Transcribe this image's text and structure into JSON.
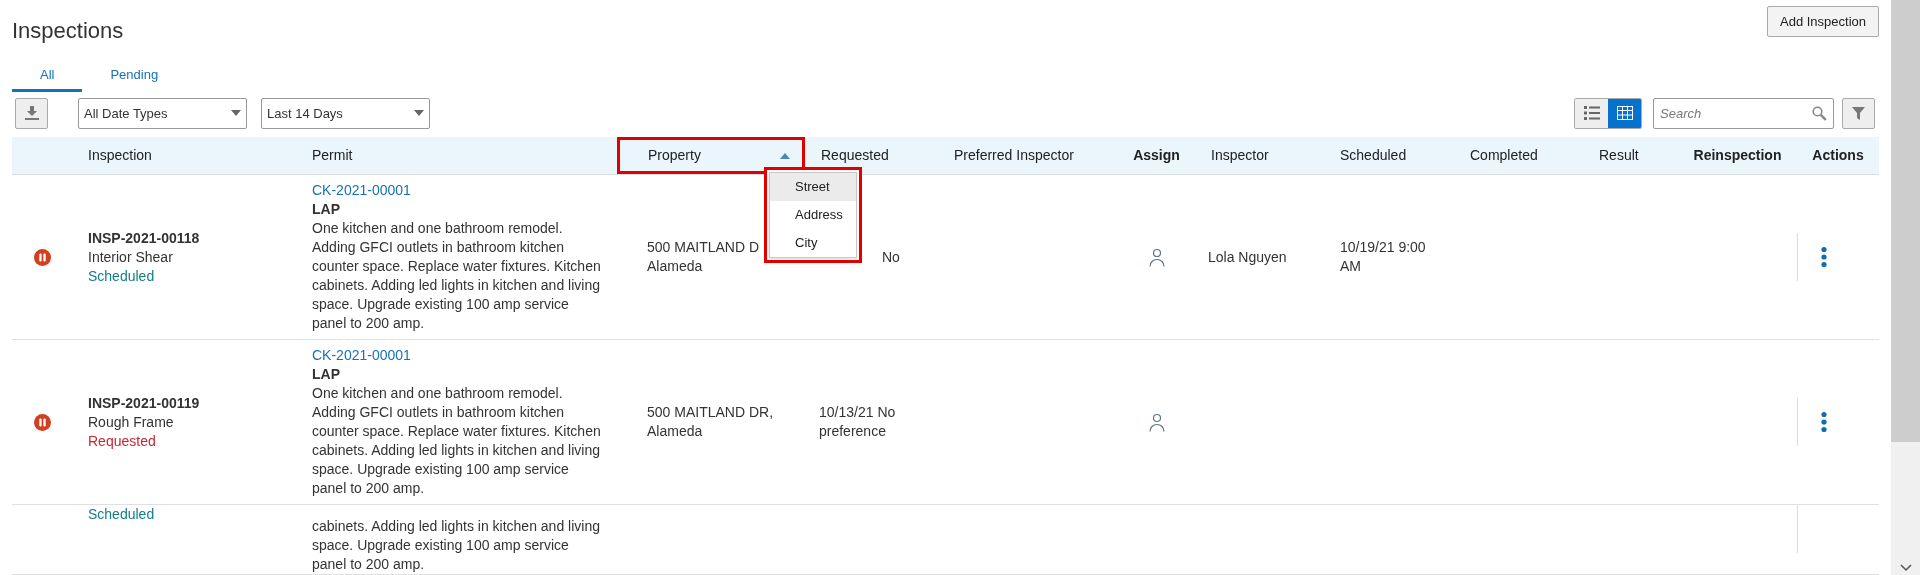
{
  "page": {
    "title": "Inspections",
    "add_button": "Add Inspection"
  },
  "tabs": [
    {
      "label": "All",
      "selected": true
    },
    {
      "label": "Pending",
      "selected": false
    }
  ],
  "filters": [
    {
      "value": "All Date Types"
    },
    {
      "value": "Last 14 Days"
    }
  ],
  "view_toggle": [
    {
      "kind": "list",
      "selected": false
    },
    {
      "kind": "table",
      "selected": true
    }
  ],
  "search": {
    "placeholder": "Search"
  },
  "table": {
    "columns": [
      {
        "label": "Inspection",
        "bold": false,
        "sorted": false,
        "highlighted": false
      },
      {
        "label": "Permit",
        "bold": false,
        "sorted": false,
        "highlighted": false
      },
      {
        "label": "Property",
        "bold": false,
        "sorted": true,
        "highlighted": true
      },
      {
        "label": "Requested",
        "bold": false,
        "sorted": false,
        "highlighted": false
      },
      {
        "label": "Preferred Inspector",
        "bold": false,
        "sorted": false,
        "highlighted": false
      },
      {
        "label": "Assign",
        "bold": true,
        "sorted": false,
        "highlighted": false
      },
      {
        "label": "Inspector",
        "bold": false,
        "sorted": false,
        "highlighted": false
      },
      {
        "label": "Scheduled",
        "bold": false,
        "sorted": false,
        "highlighted": false
      },
      {
        "label": "Completed",
        "bold": false,
        "sorted": false,
        "highlighted": false
      },
      {
        "label": "Result",
        "bold": false,
        "sorted": false,
        "highlighted": false
      },
      {
        "label": "Reinspection",
        "bold": true,
        "sorted": false,
        "highlighted": false
      },
      {
        "label": "Actions",
        "bold": true,
        "sorted": false,
        "highlighted": false
      }
    ],
    "rows": [
      {
        "kind": "full",
        "inspection_id": "INSP-2021-00118",
        "type": "Interior Shear",
        "status": {
          "text": "Scheduled",
          "color": "#147d86"
        },
        "permit": {
          "link": "CK-2021-00001",
          "code": "LAP",
          "description": "One kitchen and one bathroom remodel. Adding GFCI outlets in bathroom kitchen counter space. Replace water fixtures. Kitchen cabinets. Adding led lights in kitchen and living space. Upgrade existing 100 amp service panel to 200 amp."
        },
        "property": {
          "street": "500 MAITLAND D",
          "city": "Alameda"
        },
        "requested": "No",
        "inspector": "Lola Nguyen",
        "scheduled": "10/19/21 9:00 AM"
      },
      {
        "kind": "full",
        "inspection_id": "INSP-2021-00119",
        "type": "Rough Frame",
        "status": {
          "text": "Requested",
          "color": "#c8262c"
        },
        "permit": {
          "link": "CK-2021-00001",
          "code": "LAP",
          "description": "One kitchen and one bathroom remodel. Adding GFCI outlets in bathroom kitchen counter space. Replace water fixtures. Kitchen cabinets. Adding led lights in kitchen and living space. Upgrade existing 100 amp service panel to 200 amp."
        },
        "property": {
          "street": "500 MAITLAND DR,",
          "city": "Alameda"
        },
        "requested": "10/13/21 No preference"
      },
      {
        "kind": "partial",
        "status": {
          "text": "Scheduled",
          "color": "#147d86"
        },
        "permit": {
          "description": "cabinets. Adding led lights in kitchen and living space. Upgrade existing 100 amp service panel to 200 amp."
        }
      }
    ]
  },
  "sort_menu": {
    "highlighted": true,
    "items": [
      {
        "label": "Street",
        "selected": true
      },
      {
        "label": "Address",
        "selected": false
      },
      {
        "label": "City",
        "selected": false
      }
    ]
  }
}
